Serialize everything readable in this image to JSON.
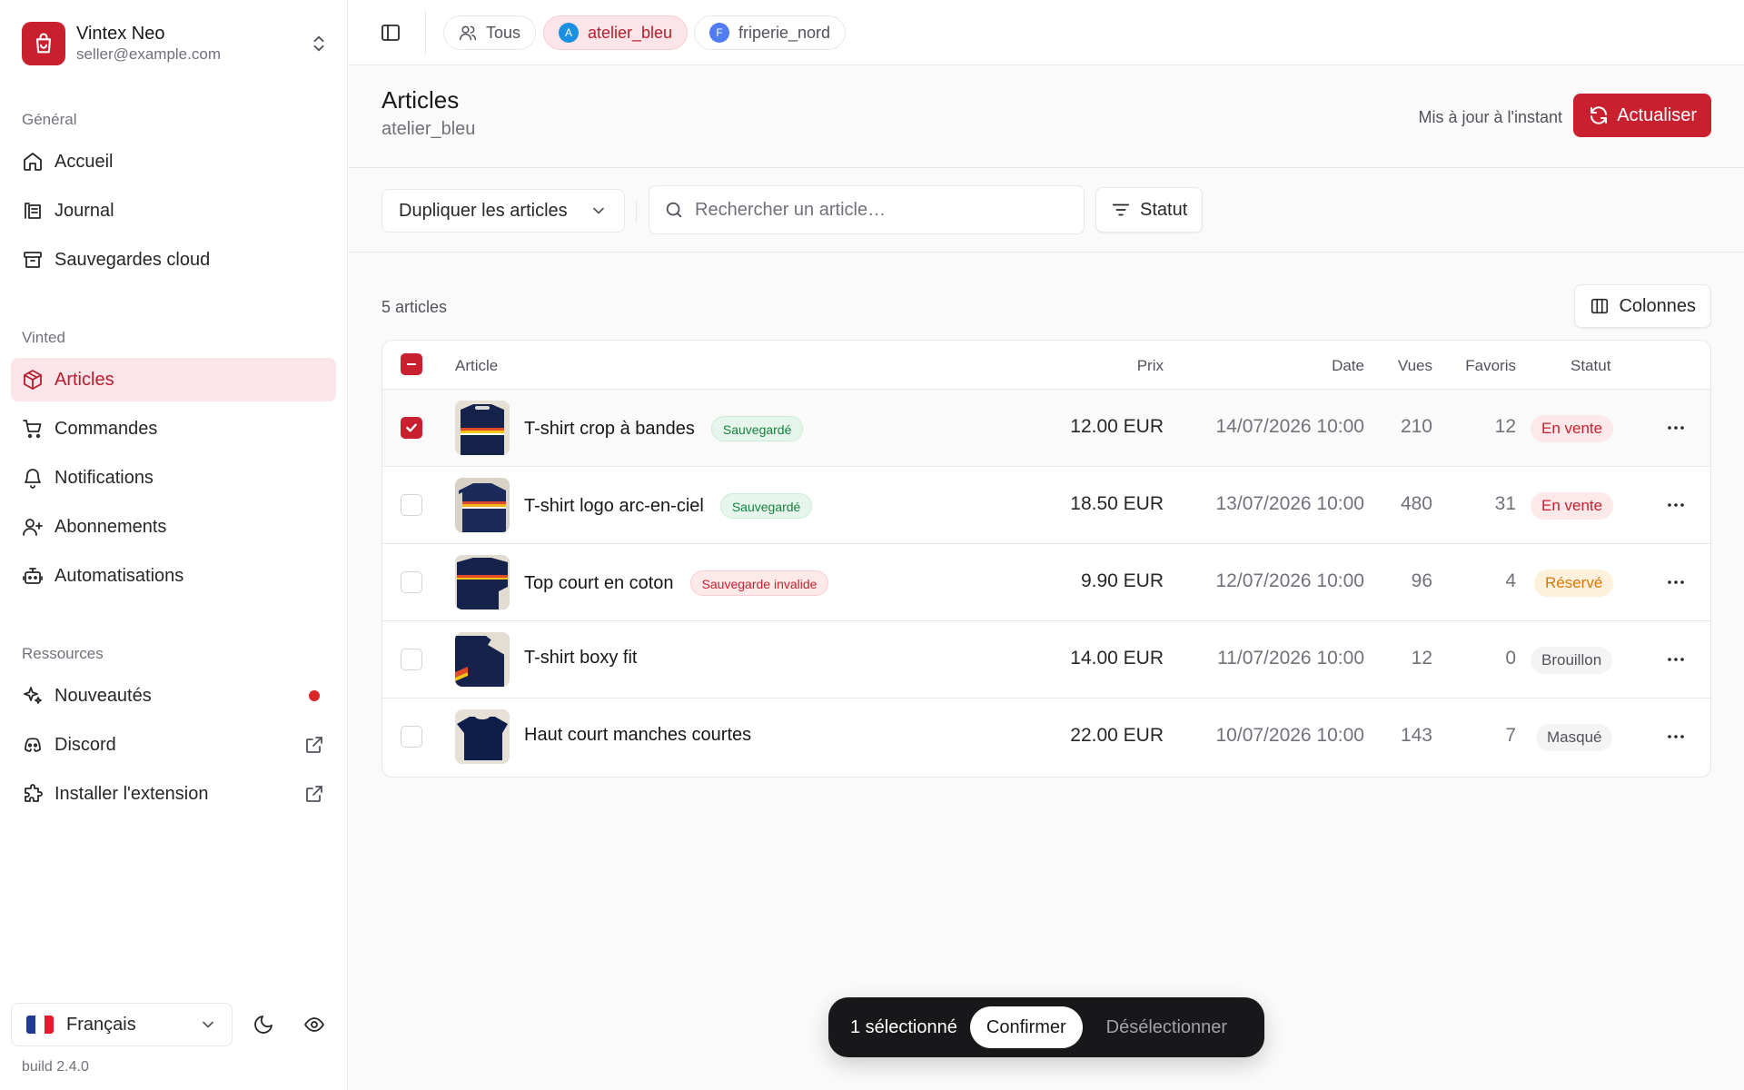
{
  "brand": {
    "name": "Vintex Neo",
    "email": "seller@example.com",
    "accent": "#c8202f"
  },
  "sidebar": {
    "sections": [
      {
        "label": "Général"
      },
      {
        "label": "Vinted"
      },
      {
        "label": "Ressources"
      }
    ],
    "items": [
      {
        "label": "Accueil",
        "icon": "home-icon"
      },
      {
        "label": "Journal",
        "icon": "log-icon"
      },
      {
        "label": "Sauvegardes cloud",
        "icon": "archive-icon"
      },
      {
        "label": "Articles",
        "icon": "package-icon",
        "active": true
      },
      {
        "label": "Commandes",
        "icon": "cart-icon"
      },
      {
        "label": "Notifications",
        "icon": "bell-icon"
      },
      {
        "label": "Abonnements",
        "icon": "user-plus-icon"
      },
      {
        "label": "Automatisations",
        "icon": "bot-icon"
      },
      {
        "label": "Nouveautés",
        "icon": "sparkles-icon",
        "dot": true
      },
      {
        "label": "Discord",
        "icon": "discord-icon",
        "external": true
      },
      {
        "label": "Installer l'extension",
        "icon": "puzzle-icon",
        "external": true
      }
    ],
    "language": "Français",
    "build": "build 2.4.0"
  },
  "topbar": {
    "accounts": [
      {
        "label": "Tous",
        "icon": "users-icon"
      },
      {
        "label": "atelier_bleu",
        "avatar": "A",
        "avatar_color": "#1d8fe0",
        "active": true
      },
      {
        "label": "friperie_nord",
        "avatar": "F",
        "avatar_color": "#4f7cf0"
      }
    ]
  },
  "header": {
    "title": "Articles",
    "subtitle": "atelier_bleu",
    "updated": "Mis à jour à l'instant",
    "refresh_label": "Actualiser"
  },
  "toolbar": {
    "duplicate_label": "Dupliquer les articles",
    "search_placeholder": "Rechercher un article…",
    "status_label": "Statut",
    "columns_label": "Colonnes"
  },
  "list": {
    "count": "5 articles",
    "columns": {
      "article": "Article",
      "price": "Prix",
      "date": "Date",
      "views": "Vues",
      "favs": "Favoris",
      "status": "Statut"
    },
    "rows": [
      {
        "title": "T-shirt crop à bandes",
        "badge": "Sauvegardé",
        "badge_type": "ok",
        "price": "12.00 EUR",
        "date": "14/07/2026 10:00",
        "views": "210",
        "favs": "12",
        "status": "En vente",
        "status_type": "sale",
        "checked": true
      },
      {
        "title": "T-shirt logo arc-en-ciel",
        "badge": "Sauvegardé",
        "badge_type": "ok",
        "price": "18.50 EUR",
        "date": "13/07/2026 10:00",
        "views": "480",
        "favs": "31",
        "status": "En vente",
        "status_type": "sale",
        "checked": false
      },
      {
        "title": "Top court en coton",
        "badge": "Sauvegarde invalide",
        "badge_type": "bad",
        "price": "9.90 EUR",
        "date": "12/07/2026 10:00",
        "views": "96",
        "favs": "4",
        "status": "Réservé",
        "status_type": "res",
        "checked": false
      },
      {
        "title": "T-shirt boxy fit",
        "badge": "",
        "badge_type": "",
        "price": "14.00 EUR",
        "date": "11/07/2026 10:00",
        "views": "12",
        "favs": "0",
        "status": "Brouillon",
        "status_type": "draft",
        "checked": false
      },
      {
        "title": "Haut court manches courtes",
        "badge": "",
        "badge_type": "",
        "price": "22.00 EUR",
        "date": "10/07/2026 10:00",
        "views": "143",
        "favs": "7",
        "status": "Masqué",
        "status_type": "draft",
        "checked": false
      }
    ]
  },
  "selection": {
    "count_label": "1 sélectionné",
    "confirm_label": "Confirmer",
    "deselect_label": "Désélectionner"
  }
}
